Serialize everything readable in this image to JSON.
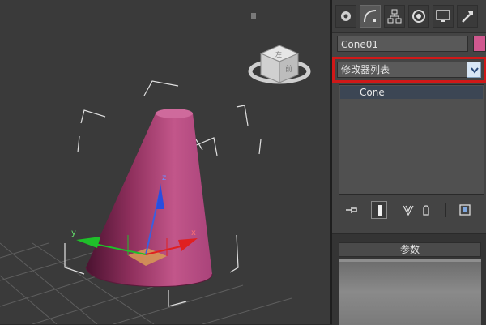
{
  "viewport": {
    "viewcube": {
      "face_top": "左",
      "face_front": "前"
    },
    "gizmo": {
      "axis_x": "x",
      "axis_y": "y",
      "axis_z": "z"
    }
  },
  "command_panel": {
    "tabs": [
      {
        "name": "create-icon"
      },
      {
        "name": "modify-icon"
      },
      {
        "name": "hierarchy-icon"
      },
      {
        "name": "motion-icon"
      },
      {
        "name": "display-icon"
      },
      {
        "name": "utilities-icon"
      }
    ],
    "object_name": "Cone01",
    "object_color": "#d0588f",
    "modifier_list": {
      "value": "修改器列表"
    },
    "stack": {
      "items": [
        "Cone"
      ]
    },
    "parameters": {
      "title": "参数",
      "toggle": "-"
    }
  },
  "colors": {
    "highlight_border": "#d01818",
    "cone": "#b5457a"
  }
}
